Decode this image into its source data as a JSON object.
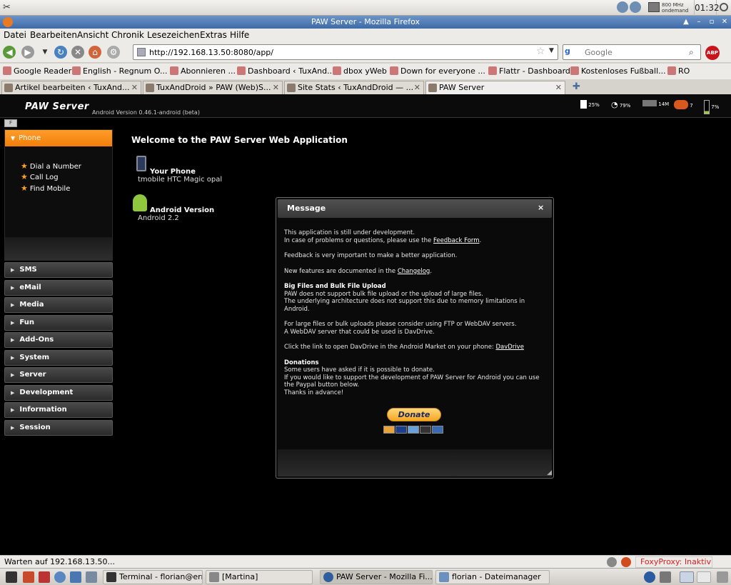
{
  "os_panel": {
    "cpu_freq_line1": "800 MHz",
    "cpu_freq_line2": "ondemand",
    "clock": "01:32"
  },
  "window": {
    "title": "PAW Server - Mozilla Firefox"
  },
  "menubar": {
    "items": [
      "Datei",
      "Bearbeiten",
      "Ansicht",
      "Chronik",
      "Lesezeichen",
      "Extras",
      "Hilfe"
    ]
  },
  "navbar": {
    "url": "http://192.168.13.50:8080/app/",
    "search_placeholder": "Google",
    "search_engine_label": "g",
    "abp_label": "ABP"
  },
  "bookmarks": [
    "Google Reader",
    "English - Regnum O...",
    "Abonnieren ...",
    "Dashboard ‹ TuxAnd...",
    "dbox yWeb",
    "Down for everyone ...",
    "Flattr - Dashboard",
    "Kostenloses Fußball...",
    "RO"
  ],
  "tabs": [
    {
      "label": "Artikel bearbeiten ‹ TuxAnd...",
      "active": false
    },
    {
      "label": "TuxAndDroid » PAW (Web)S...",
      "active": false
    },
    {
      "label": "Site Stats ‹ TuxAndDroid — ...",
      "active": false
    },
    {
      "label": "PAW Server",
      "active": true
    }
  ],
  "app": {
    "title": "PAW Server",
    "version": "Android Version 0.46.1-android (beta)",
    "status": {
      "battery_small": "25%",
      "wifi": "79%",
      "memory": "14M",
      "satellite": "7",
      "battery": "7%"
    },
    "small_icon_label": "F"
  },
  "sidebar": {
    "phone": {
      "label": "Phone",
      "items": [
        "Dial a Number",
        "Call Log",
        "Find Mobile"
      ]
    },
    "sections": [
      "SMS",
      "eMail",
      "Media",
      "Fun",
      "Add-Ons",
      "System",
      "Server",
      "Development",
      "Information",
      "Session"
    ]
  },
  "main": {
    "welcome": "Welcome to the PAW Server Web Application",
    "phone_label": "Your Phone",
    "phone_value": "tmobile HTC Magic opal",
    "android_label": "Android Version",
    "android_value": "Android 2.2"
  },
  "dialog": {
    "title": "Message",
    "close": "×",
    "p1_line1": "This application is still under development.",
    "p1_line2_pre": "In case of problems or questions, please use the ",
    "p1_link": "Feedback Form",
    "p1_line2_post": ".",
    "p2": "Feedback is very important to make a better application.",
    "p3_pre": "New features are documented in the ",
    "p3_link": "Changelog",
    "p3_post": ".",
    "bigfiles_heading": "Big Files and Bulk File Upload",
    "bigfiles_l1": "PAW does not support bulk file upload or the upload of large files.",
    "bigfiles_l2": "The underlying architecture does not support this due to memory limitations in Android.",
    "large_l1": "For large files or bulk uploads please consider using FTP or WebDAV servers.",
    "large_l2": "A WebDAV server that could be used is DavDrive.",
    "davdrive_pre": "Click the link to open DavDrive in the Android Market on your phone: ",
    "davdrive_link": "DavDrive",
    "donations_heading": "Donations",
    "don_l1": "Some users have asked if it is possible to donate.",
    "don_l2": "If you would like to support the development of PAW Server for Android you can use the Paypal button below.",
    "don_l3": "Thanks in advance!",
    "donate_button": "Donate"
  },
  "statusbar": {
    "text": "Warten auf 192.168.13.50...",
    "foxyproxy": "FoxyProxy: Inaktiv"
  },
  "taskbar": {
    "items": [
      {
        "label": "Terminal - florian@erro...",
        "active": false
      },
      {
        "label": "[Martina]",
        "active": false
      },
      {
        "label": "PAW Server - Mozilla Fi...",
        "active": true
      },
      {
        "label": "florian - Dateimanager",
        "active": false
      }
    ]
  }
}
